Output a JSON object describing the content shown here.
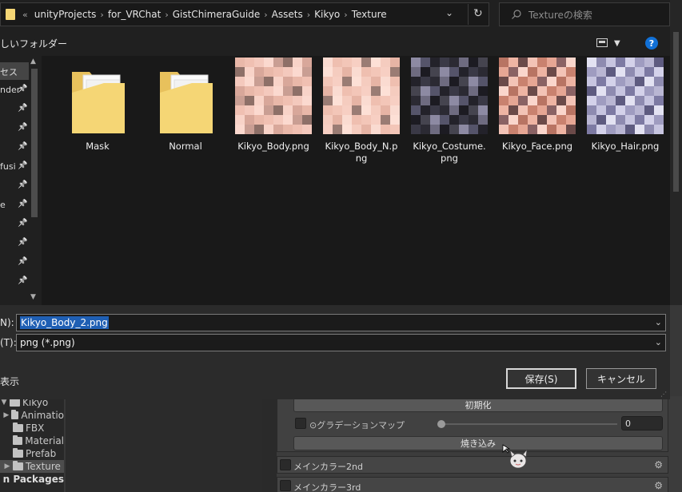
{
  "address_bar": {
    "overflow": "«",
    "crumbs": [
      "unityProjects",
      "for_VRChat",
      "GistChimeraGuide",
      "Assets",
      "Kikyo",
      "Texture"
    ],
    "separator": "›",
    "dropdown": "⌄",
    "refresh": "↻"
  },
  "search": {
    "placeholder": "Textureの検索"
  },
  "toolbar": {
    "new_folder": "しいフォルダー",
    "help": "?"
  },
  "nav_pane": {
    "items": [
      {
        "label": "セス",
        "pinned": false,
        "selected": true
      },
      {
        "label": "nder",
        "pinned": true
      },
      {
        "label": "",
        "pinned": true
      },
      {
        "label": "",
        "pinned": true
      },
      {
        "label": "",
        "pinned": true
      },
      {
        "label": "fusi",
        "pinned": true
      },
      {
        "label": "",
        "pinned": true
      },
      {
        "label": "e",
        "pinned": true
      },
      {
        "label": "",
        "pinned": true
      },
      {
        "label": "",
        "pinned": true
      },
      {
        "label": "",
        "pinned": true
      },
      {
        "label": "",
        "pinned": true
      }
    ]
  },
  "files": [
    {
      "name": "Mask",
      "type": "folder"
    },
    {
      "name": "Normal",
      "type": "folder"
    },
    {
      "name": "Kikyo_Body.png",
      "type": "image",
      "palette": "body"
    },
    {
      "name": "Kikyo_Body_N.png",
      "type": "image",
      "palette": "bodyn"
    },
    {
      "name": "Kikyo_Costume.png",
      "type": "image",
      "palette": "costume"
    },
    {
      "name": "Kikyo_Face.png",
      "type": "image",
      "palette": "face"
    },
    {
      "name": "Kikyo_Hair.png",
      "type": "image",
      "palette": "hair"
    }
  ],
  "palettes": {
    "body": [
      "#f4c9bd",
      "#f0c0b2",
      "#e9b8a9",
      "#d8a79a",
      "#f8d3c8",
      "#8e7068",
      "#c99e93",
      "#fbd9cf"
    ],
    "bodyn": [
      "#f7cfc3",
      "#f3c6b8",
      "#efbfb0",
      "#fadbd1",
      "#e6b4a5",
      "#f5ccbf",
      "#fde0d6",
      "#9a7c74"
    ],
    "costume": [
      "#2b2a33",
      "#3a3946",
      "#23222a",
      "#55546a",
      "#8d8aa3",
      "#45444f",
      "#1c1b22",
      "#6e6b80"
    ],
    "face": [
      "#e6a694",
      "#c9826f",
      "#f3c3b6",
      "#6b4a49",
      "#eeb4a3",
      "#b87463",
      "#fad6cc",
      "#8a6264"
    ],
    "hair": [
      "#b9b6d3",
      "#9f9cc0",
      "#d4d2ea",
      "#7d7aa3",
      "#c7c5e0",
      "#8e8bb0",
      "#e3e2f2",
      "#5e5b80"
    ]
  },
  "filename": {
    "label": "N):",
    "value": "Kikyo_Body_2.png"
  },
  "filetype": {
    "label": "(T):",
    "value": "png (*.png)"
  },
  "show_label": "表示",
  "buttons": {
    "save": "保存(S)",
    "cancel": "キャンセル"
  },
  "unity": {
    "tree": [
      {
        "label": "Kikyo",
        "arrow": "▼",
        "folder": true,
        "indent": 0,
        "selected": false,
        "bold": false
      },
      {
        "label": "Animatio",
        "arrow": "▶",
        "folder": true,
        "indent": 1,
        "selected": false,
        "bold": false
      },
      {
        "label": "FBX",
        "arrow": "",
        "folder": true,
        "indent": 1,
        "selected": false,
        "bold": false
      },
      {
        "label": "Material",
        "arrow": "",
        "folder": true,
        "indent": 1,
        "selected": false,
        "bold": false
      },
      {
        "label": "Prefab",
        "arrow": "",
        "folder": true,
        "indent": 1,
        "selected": false,
        "bold": false
      },
      {
        "label": "Texture",
        "arrow": "▶",
        "folder": true,
        "indent": 1,
        "selected": true,
        "bold": false
      },
      {
        "label": "n Packages",
        "arrow": "",
        "folder": false,
        "indent": 0,
        "selected": false,
        "bold": true
      }
    ],
    "inspector": {
      "init_button": "初期化",
      "gradation_map_label": "⊙グラデーションマップ",
      "gradation_value": "0",
      "gradation_level": 0,
      "bake_button": "焼き込み",
      "section_main2": "メインカラー2nd",
      "section_main3": "メインカラー3rd"
    }
  },
  "colors": {
    "selection": "#1f5fb4",
    "help_icon": "#1170d6",
    "folder_fill": "#f5d675"
  }
}
